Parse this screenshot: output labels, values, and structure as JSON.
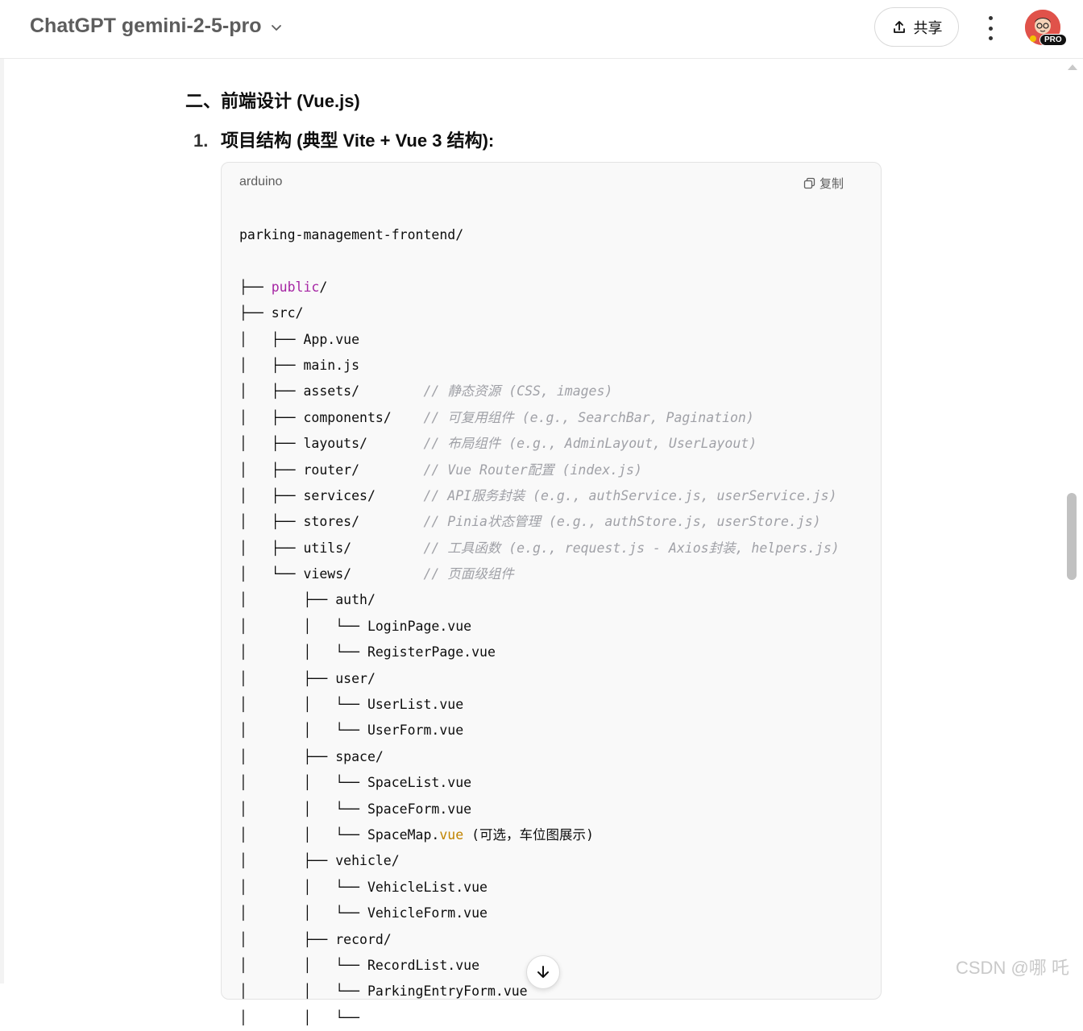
{
  "header": {
    "model_title": "ChatGPT gemini-2-5-pro",
    "share_label": "共享",
    "avatar_badge": "PRO"
  },
  "content": {
    "section_heading": "二、前端设计 (Vue.js)",
    "item_number": "1.",
    "item_heading": "项目结构 (典型 Vite + Vue 3 结构):",
    "code_block": {
      "language": "arduino",
      "copy_label": "复制",
      "lines": [
        [
          {
            "t": "parking-management-frontend/",
            "c": ""
          }
        ],
        [
          {
            "t": "",
            "c": ""
          }
        ],
        [
          {
            "t": "├── ",
            "c": ""
          },
          {
            "t": "public",
            "c": "kw"
          },
          {
            "t": "/",
            "c": ""
          }
        ],
        [
          {
            "t": "├── src/",
            "c": ""
          }
        ],
        [
          {
            "t": "│   ├── App.vue",
            "c": ""
          }
        ],
        [
          {
            "t": "│   ├── main.js",
            "c": ""
          }
        ],
        [
          {
            "t": "│   ├── assets/        ",
            "c": ""
          },
          {
            "t": "// 静态资源 (CSS, images)",
            "c": "cm"
          }
        ],
        [
          {
            "t": "│   ├── components/    ",
            "c": ""
          },
          {
            "t": "// 可复用组件 (e.g., SearchBar, Pagination)",
            "c": "cm"
          }
        ],
        [
          {
            "t": "│   ├── layouts/       ",
            "c": ""
          },
          {
            "t": "// 布局组件 (e.g., AdminLayout, UserLayout)",
            "c": "cm"
          }
        ],
        [
          {
            "t": "│   ├── router/        ",
            "c": ""
          },
          {
            "t": "// Vue Router配置 (index.js)",
            "c": "cm"
          }
        ],
        [
          {
            "t": "│   ├── services/      ",
            "c": ""
          },
          {
            "t": "// API服务封装 (e.g., authService.js, userService.js)",
            "c": "cm"
          }
        ],
        [
          {
            "t": "│   ├── stores/        ",
            "c": ""
          },
          {
            "t": "// Pinia状态管理 (e.g., authStore.js, userStore.js)",
            "c": "cm"
          }
        ],
        [
          {
            "t": "│   ├── utils/         ",
            "c": ""
          },
          {
            "t": "// 工具函数 (e.g., request.js - Axios封装, helpers.js)",
            "c": "cm"
          }
        ],
        [
          {
            "t": "│   └── views/         ",
            "c": ""
          },
          {
            "t": "// 页面级组件",
            "c": "cm"
          }
        ],
        [
          {
            "t": "│       ├── auth/",
            "c": ""
          }
        ],
        [
          {
            "t": "│       │   └── LoginPage.vue",
            "c": ""
          }
        ],
        [
          {
            "t": "│       │   └── RegisterPage.vue",
            "c": ""
          }
        ],
        [
          {
            "t": "│       ├── user/",
            "c": ""
          }
        ],
        [
          {
            "t": "│       │   └── UserList.vue",
            "c": ""
          }
        ],
        [
          {
            "t": "│       │   └── UserForm.vue",
            "c": ""
          }
        ],
        [
          {
            "t": "│       ├── space/",
            "c": ""
          }
        ],
        [
          {
            "t": "│       │   └── SpaceList.vue",
            "c": ""
          }
        ],
        [
          {
            "t": "│       │   └── SpaceForm.vue",
            "c": ""
          }
        ],
        [
          {
            "t": "│       │   └── SpaceMap.",
            "c": ""
          },
          {
            "t": "vue",
            "c": "vue"
          },
          {
            "t": " (可选，车位图展示)",
            "c": ""
          }
        ],
        [
          {
            "t": "│       ├── vehicle/",
            "c": ""
          }
        ],
        [
          {
            "t": "│       │   └── VehicleList.vue",
            "c": ""
          }
        ],
        [
          {
            "t": "│       │   └── VehicleForm.vue",
            "c": ""
          }
        ],
        [
          {
            "t": "│       ├── record/",
            "c": ""
          }
        ],
        [
          {
            "t": "│       │   └── RecordList.vue",
            "c": ""
          }
        ],
        [
          {
            "t": "│       │   └── ParkingEntryForm.vue",
            "c": ""
          }
        ],
        [
          {
            "t": "│       │   └──",
            "c": ""
          }
        ]
      ]
    }
  },
  "watermark": "CSDN @哪 吒",
  "icons": {
    "chevron": "chevron-down-icon",
    "share": "share-icon",
    "more": "more-vertical-icon",
    "copy": "copy-icon",
    "scroll_down": "arrow-down-icon"
  }
}
